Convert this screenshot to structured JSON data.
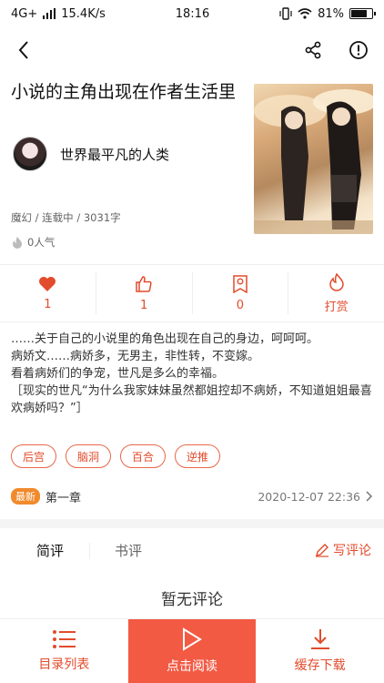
{
  "status_bar": {
    "network": "4G+",
    "speed": "15.4K/s",
    "time": "18:16",
    "battery": "81%",
    "battery_level": 0.81
  },
  "book": {
    "title": "小说的主角出现在作者生活里",
    "author": "世界最平凡的人类",
    "meta": "魔幻 / 连载中 / 3031字",
    "popularity": "0人气"
  },
  "stats": [
    {
      "icon": "heart-icon",
      "value": "1"
    },
    {
      "icon": "thumbs-up-icon",
      "value": "1"
    },
    {
      "icon": "bookmark-badge-icon",
      "value": "0"
    },
    {
      "icon": "flame-icon",
      "value": "打赏"
    }
  ],
  "intro": [
    "……关于自己的小说里的角色出现在自己的身边，呵呵呵。",
    "病娇文……病娇多，无男主，非性转，不变嫁。",
    "看着病娇们的争宠，世凡是多么的幸福。",
    "［现实的世凡“为什么我家妹妹虽然都姐控却不病娇，不知道姐姐最喜欢病娇吗？”］"
  ],
  "tags": [
    "后宫",
    "脑洞",
    "百合",
    "逆推"
  ],
  "latest": {
    "badge": "最新",
    "chapter": "第一章",
    "time": "2020-12-07 22:36"
  },
  "comments": {
    "tab_short": "简评",
    "tab_review": "书评",
    "write": "写评论",
    "empty": "暂无评论"
  },
  "bottom": {
    "toc": "目录列表",
    "read": "点击阅读",
    "download": "缓存下载"
  },
  "colors": {
    "accent": "#e24b2b",
    "read_button": "#f25a44",
    "badge": "#f08a2c"
  }
}
